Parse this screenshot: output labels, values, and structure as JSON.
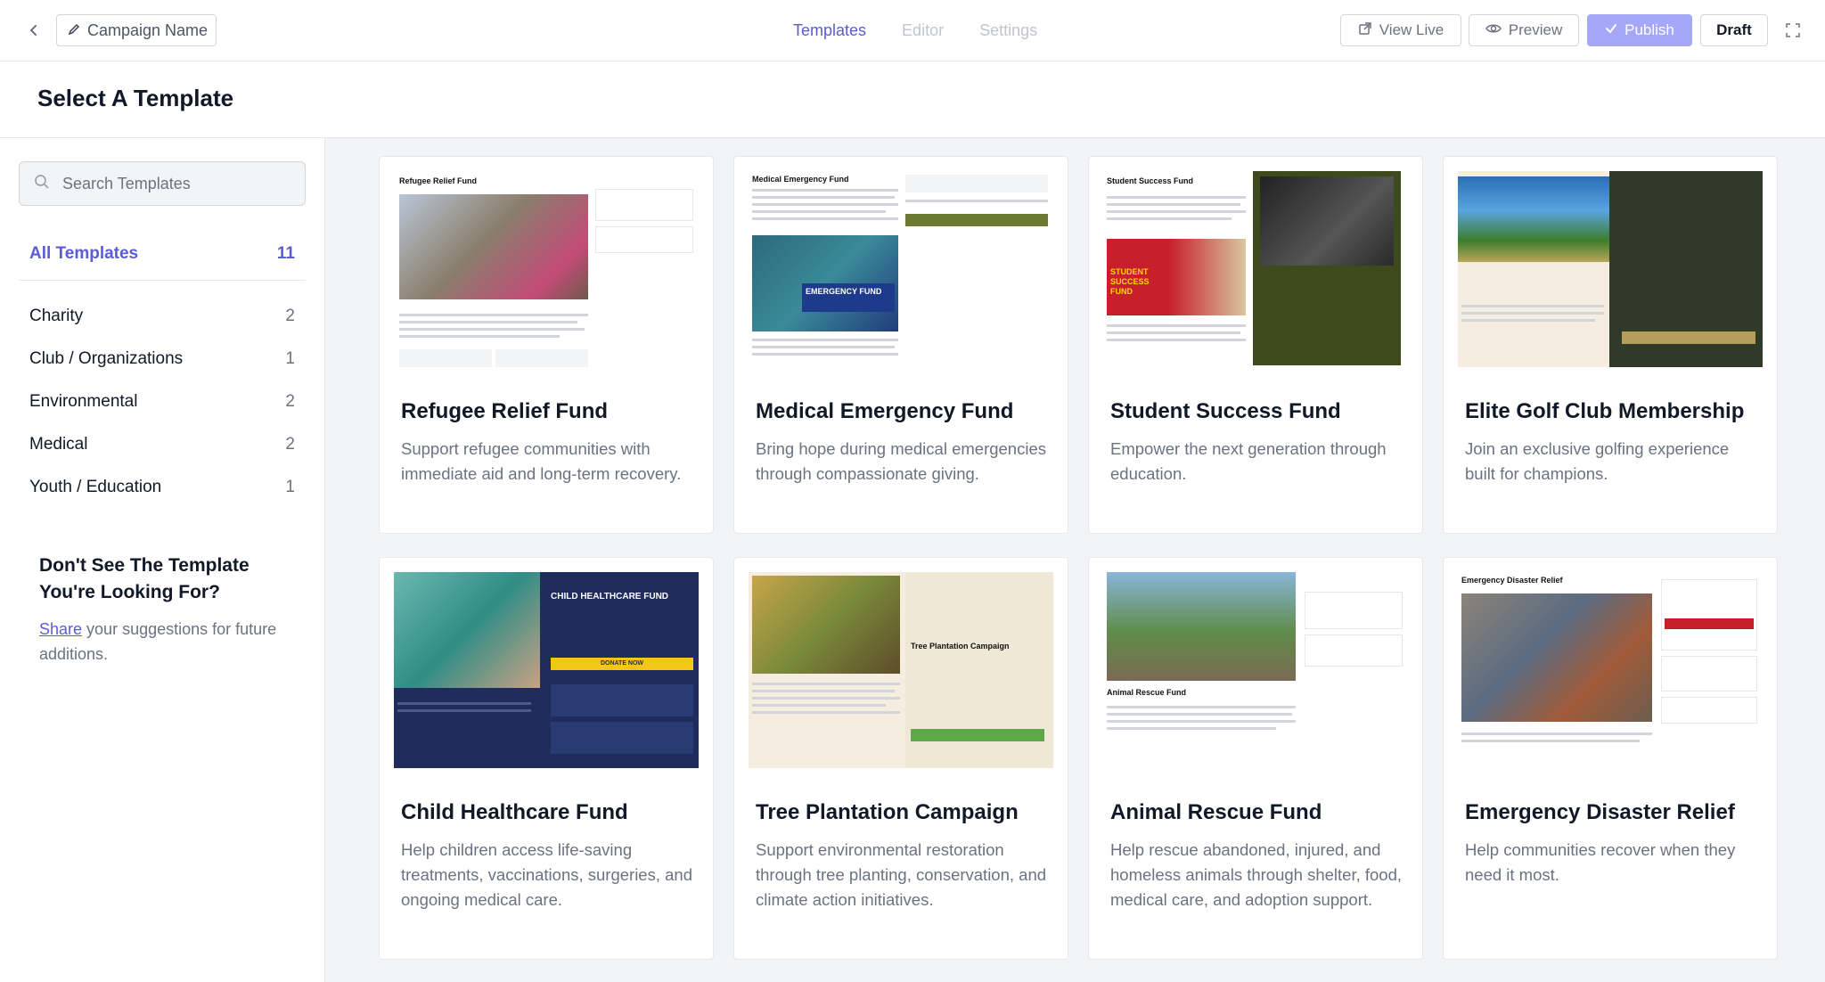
{
  "header": {
    "campaign_name": "Campaign Name",
    "tabs": [
      {
        "label": "Templates",
        "active": true
      },
      {
        "label": "Editor",
        "active": false
      },
      {
        "label": "Settings",
        "active": false
      }
    ],
    "view_live": "View Live",
    "preview": "Preview",
    "publish": "Publish",
    "draft": "Draft"
  },
  "page_title": "Select A Template",
  "sidebar": {
    "search_placeholder": "Search Templates",
    "all": {
      "label": "All Templates",
      "count": "11"
    },
    "categories": [
      {
        "label": "Charity",
        "count": "2"
      },
      {
        "label": "Club / Organizations",
        "count": "1"
      },
      {
        "label": "Environmental",
        "count": "2"
      },
      {
        "label": "Medical",
        "count": "2"
      },
      {
        "label": "Youth / Education",
        "count": "1"
      }
    ],
    "suggest": {
      "title": "Don't See The Template You're Looking For?",
      "link": "Share",
      "text": " your suggestions for future additions."
    }
  },
  "templates": [
    {
      "title": "Refugee Relief Fund",
      "desc": "Support refugee communities with immediate aid and long-term recovery."
    },
    {
      "title": "Medical Emergency Fund",
      "desc": "Bring hope during medical emergencies through compassionate giving."
    },
    {
      "title": "Student Success Fund",
      "desc": "Empower the next generation through education."
    },
    {
      "title": "Elite Golf Club Membership",
      "desc": "Join an exclusive golfing experience built for champions."
    },
    {
      "title": "Child Healthcare Fund",
      "desc": "Help children access life-saving treatments, vaccinations, surgeries, and ongoing medical care."
    },
    {
      "title": "Tree Plantation Campaign",
      "desc": "Support environmental restoration through tree planting, conservation, and climate action initiatives."
    },
    {
      "title": "Animal Rescue Fund",
      "desc": "Help rescue abandoned, injured, and homeless animals through shelter, food, medical care, and adoption support."
    },
    {
      "title": "Emergency Disaster Relief",
      "desc": "Help communities recover when they need it most."
    }
  ],
  "thumb_text": {
    "refugee_heading": "Refugee Relief Fund",
    "medical_heading": "Medical Emergency Fund",
    "medical_badge": "EMERGENCY FUND",
    "student_heading": "Student Success Fund",
    "student_badge": "STUDENT SUCCESS FUND",
    "child_banner": "CHILD HEALTHCARE FUND",
    "child_donate": "DONATE NOW",
    "tree_heading": "Tree Plantation Campaign",
    "animal_heading": "Animal Rescue Fund",
    "disaster_heading": "Emergency Disaster Relief"
  },
  "colors": {
    "accent": "#5b5bd6",
    "publish_bg": "#a5a8f6"
  }
}
